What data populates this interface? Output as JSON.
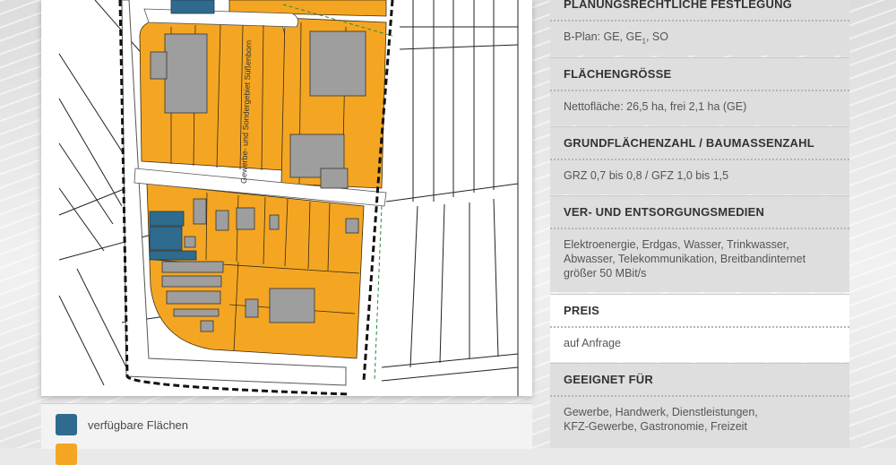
{
  "panel": {
    "sections": [
      {
        "title": "PLANUNGSRECHTLICHE FESTLEGUNG",
        "lines": [
          "B-Plan: GE, GE",
          "1",
          ", SO"
        ]
      },
      {
        "title": "FLÄCHENGRÖSSE",
        "lines": [
          "Nettofläche: 26,5 ha, frei 2,1 ha (GE)"
        ]
      },
      {
        "title": "GRUNDFLÄCHENZAHL / BAUMASSENZAHL",
        "lines": [
          "GRZ 0,7 bis 0,8 / GFZ 1,0 bis 1,5"
        ]
      },
      {
        "title": "VER- UND ENTSORGUNGSMEDIEN",
        "lines": [
          "Elektroenergie, Erdgas, Wasser, Trinkwasser,",
          "Abwasser, Telekommunikation, Breitbandinternet",
          "größer 50 MBit/s"
        ]
      },
      {
        "title": "PREIS",
        "lines": [
          "auf Anfrage"
        ]
      },
      {
        "title": "GEEIGNET FÜR",
        "lines": [
          "Gewerbe, Handwerk, Dienstleistungen,",
          "KFZ-Gewerbe, Gastronomie, Freizeit"
        ]
      }
    ]
  },
  "map": {
    "area_label": "Gewerbe- und Sondergebiet Süßenborn",
    "colors": {
      "available": "#2e6b8f",
      "occupied": "#f4a623",
      "building": "#9e9e9e"
    }
  },
  "legend": {
    "items": [
      {
        "label": "verfügbare Flächen",
        "color": "#2e6b8f"
      },
      {
        "label": "",
        "color": "#f4a623"
      }
    ]
  }
}
